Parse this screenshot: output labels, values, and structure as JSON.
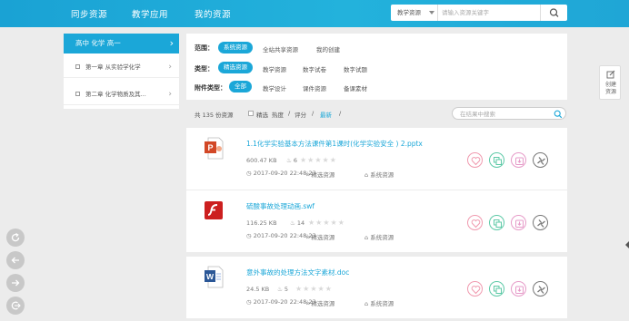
{
  "header": {
    "nav": [
      "同步资源",
      "教学应用",
      "我的资源"
    ],
    "search": {
      "scope_label": "教学资源",
      "placeholder": "请输入资源关键字"
    }
  },
  "sidebar": {
    "head": "高中 化学 高一",
    "items": [
      "第一章 从实验学化学",
      "第二章 化学物质及其..."
    ]
  },
  "filters": {
    "scope": {
      "label": "范围：",
      "selected": "系统资源",
      "options": [
        "全站共享资源",
        "我的创建"
      ]
    },
    "type": {
      "label": "类型：",
      "selected": "精选资源",
      "options": [
        "教学资源",
        "数字试卷",
        "数字试题"
      ]
    },
    "attachment": {
      "label": "附件类型：",
      "selected": "全部",
      "options": [
        "教学设计",
        "课件资源",
        "备课素材"
      ]
    }
  },
  "sortbar": {
    "total": "共 135 份资源",
    "featured": "精选",
    "hot": "热度",
    "sep1": "/",
    "rating": "评分",
    "sep2": "/",
    "newest": "最新",
    "sep3": "/",
    "search_placeholder": "在结果中搜索"
  },
  "resources": [
    {
      "title": "1.1化学实验基本方法课件第1课时(化学实验安全 ) 2.pptx",
      "size": "600.47 KB",
      "views": "6",
      "stars": "★★★★★",
      "date": "2017-09-20 22:48:23",
      "category": "精选资源",
      "source": "系统资源",
      "file_icon": "powerpoint-icon"
    },
    {
      "title": "硫酸事故处理动画.swf",
      "size": "116.25 KB",
      "views": "14",
      "stars": "★★★★★",
      "date": "2017-09-20 22:48:23",
      "category": "精选资源",
      "source": "系统资源",
      "file_icon": "flash-icon"
    },
    {
      "title": "意外事故的处理方法文字素材.doc",
      "size": "24.5 KB",
      "views": "5",
      "stars": "★★★★★",
      "date": "2017-09-20 22:48:23",
      "category": "精选资源",
      "source": "系统资源",
      "file_icon": "word-icon"
    }
  ],
  "side_tool": {
    "label1": "创建",
    "label2": "资源"
  },
  "colors": {
    "accent": "#1ba7d8",
    "favorite": "#f09aaf",
    "copy": "#5cc9a6",
    "download": "#e69ac8",
    "more": "#777777"
  }
}
